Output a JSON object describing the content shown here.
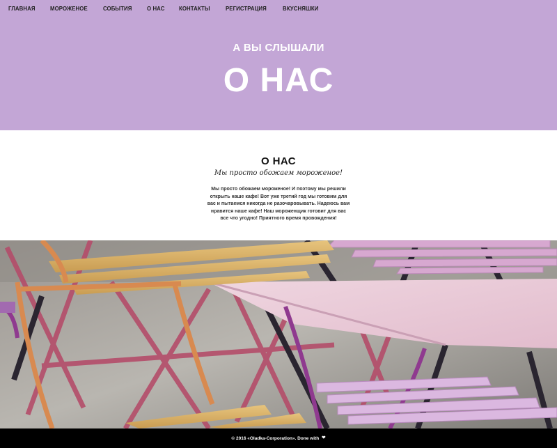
{
  "nav": {
    "items": [
      {
        "label": "ГЛАВНАЯ"
      },
      {
        "label": "МОРОЖЕНОЕ"
      },
      {
        "label": "СОБЫТИЯ"
      },
      {
        "label": "О НАС"
      },
      {
        "label": "КОНТАКТЫ"
      },
      {
        "label": "РЕГИСТРАЦИЯ"
      },
      {
        "label": "ВКУСНЯШКИ"
      }
    ]
  },
  "hero": {
    "subtitle": "А ВЫ СЛЫШАЛИ",
    "title": "О НАС",
    "background": "#c3a6d6"
  },
  "about": {
    "title": "О НАС",
    "tagline": "Мы просто обожаем мороженое!",
    "text": "Мы просто обожаем мороженое! И поэтому мы решили открыть наше кафе! Вот уже третий год мы готовим для вас и пытаемся никогда не разочаровывать. Надеюсь вам нравится наше кафе! Наш мороженщик готовит для вас все что угодно! Приятного время провождения!"
  },
  "photo": {
    "icon": "cafe-chairs-photo"
  },
  "footer": {
    "copyright": "© 2016 «Oladka-Corporation». Done with",
    "heart_icon": "heart-icon",
    "heart_color": "#e0262a"
  }
}
